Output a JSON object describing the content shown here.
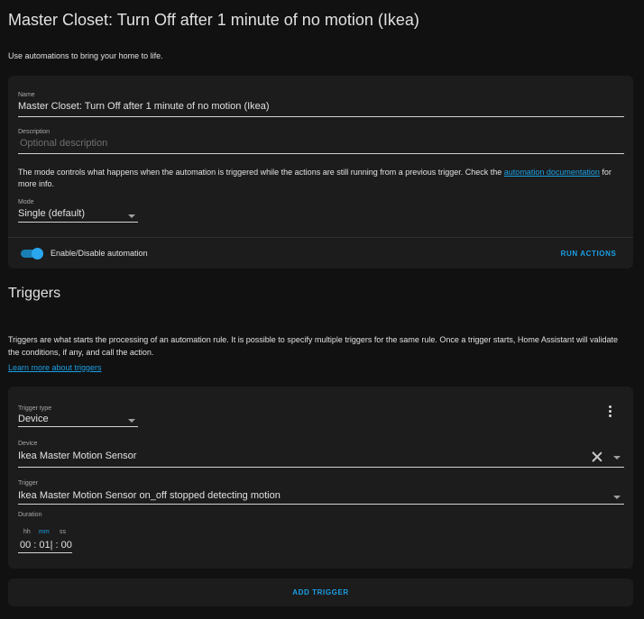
{
  "page": {
    "title": "Master Closet: Turn Off after 1 minute of no motion (Ikea)",
    "intro": "Use automations to bring your home to life."
  },
  "details": {
    "name_label": "Name",
    "name_value": "Master Closet: Turn Off after 1 minute of no motion (Ikea)",
    "description_label": "Description",
    "description_placeholder": "Optional description",
    "mode_note_before": "The mode controls what happens when the automation is triggered while the actions are still running from a previous trigger. Check the ",
    "mode_note_link": "automation documentation",
    "mode_note_after": " for more info.",
    "mode_label": "Mode",
    "mode_value": "Single (default)",
    "toggle_label": "Enable/Disable automation",
    "toggle_on": true,
    "run_actions_label": "RUN ACTIONS"
  },
  "triggers": {
    "title": "Triggers",
    "description": "Triggers are what starts the processing of an automation rule. It is possible to specify multiple triggers for the same rule. Once a trigger starts, Home Assistant will validate the conditions, if any, and call the action.",
    "learn_more": "Learn more about triggers",
    "trigger_type_label": "Trigger type",
    "trigger_type_value": "Device",
    "device_label": "Device",
    "device_value": "Ikea Master Motion Sensor",
    "trigger_label": "Trigger",
    "trigger_value": "Ikea Master Motion Sensor on_off stopped detecting motion",
    "duration_label": "Duration",
    "duration_units": {
      "hh": "hh",
      "mm": "mm",
      "ss": "ss"
    },
    "duration_value": "00 : 01| : 00",
    "add_trigger_label": "ADD TRIGGER"
  },
  "colors": {
    "accent": "#1a9fe5",
    "background": "#111111",
    "card": "#1c1c1c"
  },
  "icons": [
    "toggle-switch",
    "dropdown-caret-icon",
    "kebab-menu-icon",
    "close-icon"
  ]
}
